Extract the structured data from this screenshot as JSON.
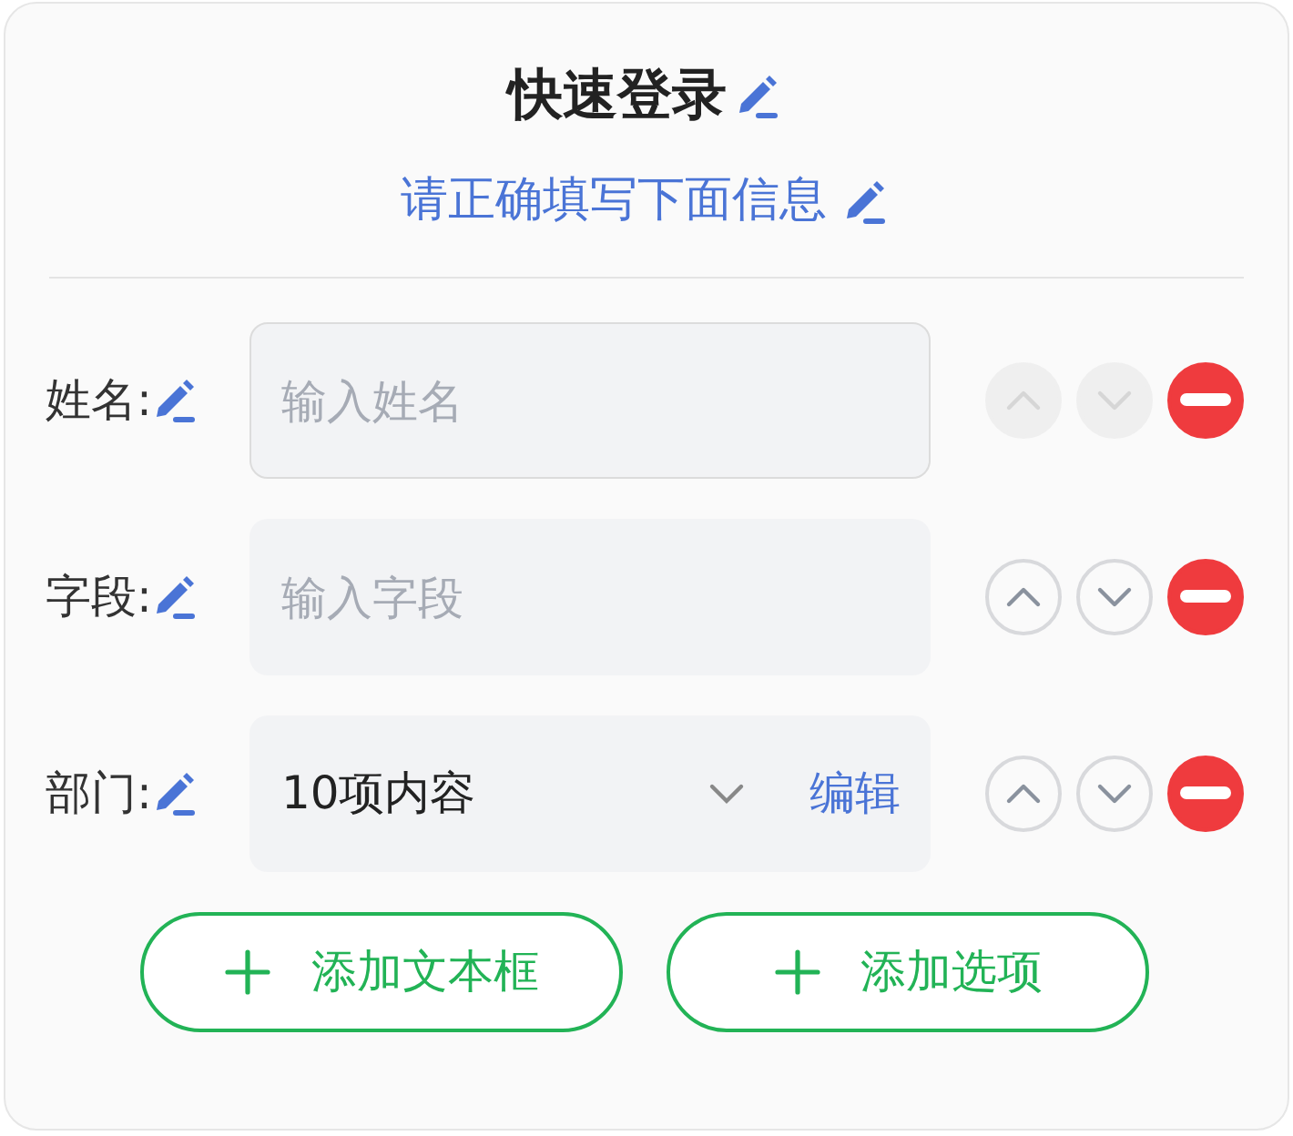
{
  "title": "快速登录",
  "subtitle": "请正确填写下面信息",
  "fields": [
    {
      "kind": "input",
      "label": "姓名:",
      "placeholder": "输入姓名",
      "focused": true,
      "up_disabled": true,
      "down_disabled": true
    },
    {
      "kind": "input",
      "label": "字段:",
      "placeholder": "输入字段",
      "focused": false,
      "up_disabled": false,
      "down_disabled": false
    },
    {
      "kind": "select",
      "label": "部门:",
      "value": "10项内容",
      "action": "编辑",
      "focused": false,
      "up_disabled": false,
      "down_disabled": false
    }
  ],
  "buttons": [
    "添加文本框",
    "添加选项"
  ]
}
